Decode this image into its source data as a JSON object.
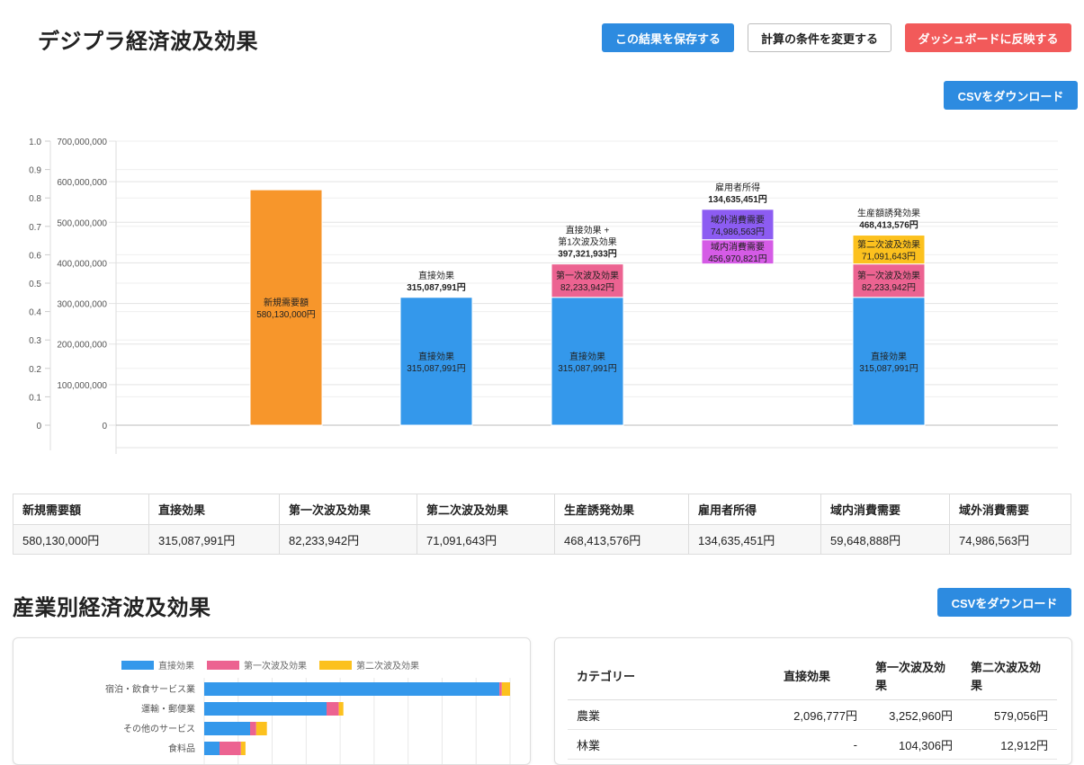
{
  "header": {
    "title": "デジプラ経済波及効果",
    "save_button": "この結果を保存する",
    "change_button": "計算の条件を変更する",
    "dashboard_button": "ダッシュボードに反映する"
  },
  "csv_button_top": "CSVをダウンロード",
  "csv_button_industry": "CSVをダウンロード",
  "colors": {
    "accent": "#2d8be0",
    "danger": "#f25a5a",
    "orange": "#f7962b",
    "blue": "#3498eb",
    "pink": "#ec6391",
    "yellow": "#fcc11e",
    "purple": "#8c5cf2",
    "magenta": "#d55be6"
  },
  "chart_data": [
    {
      "type": "bar",
      "left_axis_ticks": [
        "1.0",
        "0.9",
        "0.8",
        "0.7",
        "0.6",
        "0.5",
        "0.4",
        "0.3",
        "0.2",
        "0.1",
        "0"
      ],
      "right_axis_ticks": [
        "700,000,000",
        "600,000,000",
        "500,000,000",
        "400,000,000",
        "300,000,000",
        "200,000,000",
        "100,000,000",
        "0"
      ],
      "ylim": [
        0,
        700000000
      ],
      "grid": true,
      "bars": [
        {
          "total_label": "",
          "total_value": "",
          "segments": [
            {
              "label": "新規需要額",
              "value_label": "580,130,000円",
              "value": 580130000,
              "color": "#f7962b"
            }
          ]
        },
        {
          "total_label": "直接効果",
          "total_value": "315,087,991円",
          "segments": [
            {
              "label": "直接効果",
              "value_label": "315,087,991円",
              "value": 315087991,
              "color": "#3498eb"
            }
          ]
        },
        {
          "total_label": "直接効果 +\n第1次波及効果",
          "total_value": "397,321,933円",
          "segments": [
            {
              "label": "直接効果",
              "value_label": "315,087,991円",
              "value": 315087991,
              "color": "#3498eb"
            },
            {
              "label": "第一次波及効果",
              "value_label": "82,233,942円",
              "value": 82233942,
              "color": "#ec6391"
            }
          ]
        },
        {
          "total_label": "雇用者所得",
          "total_value": "134,635,451円",
          "floating_base": 397321933,
          "segments": [
            {
              "label": "域内消費需要",
              "value_label": "456,970,821円",
              "value": 59648888,
              "color": "#d55be6"
            },
            {
              "label": "域外消費需要",
              "value_label": "74,986,563円",
              "value": 74986563,
              "color": "#8c5cf2"
            }
          ]
        },
        {
          "total_label": "生産額誘発効果",
          "total_value": "468,413,576円",
          "segments": [
            {
              "label": "直接効果",
              "value_label": "315,087,991円",
              "value": 315087991,
              "color": "#3498eb"
            },
            {
              "label": "第一次波及効果",
              "value_label": "82,233,942円",
              "value": 82233942,
              "color": "#ec6391"
            },
            {
              "label": "第二次波及効果",
              "value_label": "71,091,643円",
              "value": 71091643,
              "color": "#fcc11e"
            }
          ]
        }
      ]
    },
    {
      "type": "bar",
      "orientation": "horizontal",
      "stacked": true,
      "legend_position": "top",
      "categories": [
        "宿泊・飲食サービス業",
        "運輸・郵便業",
        "その他のサービス",
        "食料品"
      ],
      "series": [
        {
          "name": "直接効果",
          "color": "#3498eb",
          "values": [
            0.965,
            0.4,
            0.15,
            0.05
          ]
        },
        {
          "name": "第一次波及効果",
          "color": "#ec6391",
          "values": [
            0.008,
            0.04,
            0.02,
            0.07
          ]
        },
        {
          "name": "第二次波及効果",
          "color": "#fcc11e",
          "values": [
            0.027,
            0.015,
            0.035,
            0.015
          ]
        }
      ]
    }
  ],
  "summary": {
    "headers": [
      "新規需要額",
      "直接効果",
      "第一次波及効果",
      "第二次波及効果",
      "生産誘発効果",
      "雇用者所得",
      "域内消費需要",
      "域外消費需要"
    ],
    "values": [
      "580,130,000円",
      "315,087,991円",
      "82,233,942円",
      "71,091,643円",
      "468,413,576円",
      "134,635,451円",
      "59,648,888円",
      "74,986,563円"
    ]
  },
  "industry": {
    "title": "産業別経済波及効果",
    "table_headers": [
      "カテゴリー",
      "直接効果",
      "第一次波及効果",
      "第二次波及効果"
    ],
    "rows": [
      [
        "農業",
        "2,096,777円",
        "3,252,960円",
        "579,056円"
      ],
      [
        "林業",
        "-",
        "104,306円",
        "12,912円"
      ]
    ]
  }
}
